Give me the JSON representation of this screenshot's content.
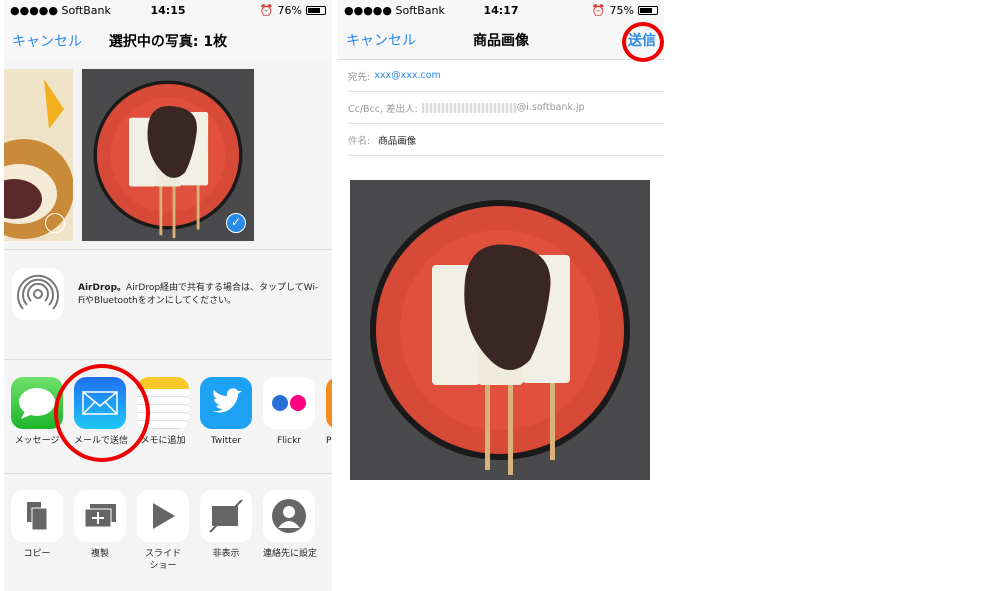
{
  "left": {
    "status": {
      "carrier": "●●●●● SoftBank",
      "time": "14:15",
      "battery": "76%",
      "battery_level": 0.76
    },
    "nav": {
      "cancel": "キャンセル",
      "title": "選択中の写真: 1枚"
    },
    "airdrop": {
      "bold": "AirDrop。",
      "text": "AirDrop経由で共有する場合は、タップしてWi-FiやBluetoothをオンにしてください。"
    },
    "apps": [
      {
        "label": "メッセージ",
        "icon": "messages-icon"
      },
      {
        "label": "メールで送信",
        "icon": "mail-icon"
      },
      {
        "label": "メモに追加",
        "icon": "notes-icon"
      },
      {
        "label": "Twitter",
        "icon": "twitter-icon"
      },
      {
        "label": "Flickr",
        "icon": "flickr-icon"
      },
      {
        "label": "PD",
        "icon": "app-icon"
      }
    ],
    "actions": [
      {
        "label": "コピー",
        "icon": "copy-icon"
      },
      {
        "label": "複製",
        "icon": "duplicate-icon"
      },
      {
        "label": "スライドショー",
        "icon": "slideshow-icon"
      },
      {
        "label": "非表示",
        "icon": "hide-icon"
      },
      {
        "label": "連絡先に設定",
        "icon": "contact-icon"
      }
    ]
  },
  "right": {
    "status": {
      "carrier": "●●●●● SoftBank",
      "time": "14:17",
      "battery": "75%",
      "battery_level": 0.75
    },
    "nav": {
      "cancel": "キャンセル",
      "title": "商品画像",
      "send": "送信"
    },
    "to_label": "宛先:",
    "to_value": "xxx@xxx.com",
    "cc_label": "Cc/Bcc, 差出人:",
    "cc_value": "@i.softbank.jp",
    "subject_label": "件名:",
    "subject_value": "商品画像"
  },
  "colors": {
    "accent": "#2a8ae8",
    "highlight": "#e00000"
  }
}
